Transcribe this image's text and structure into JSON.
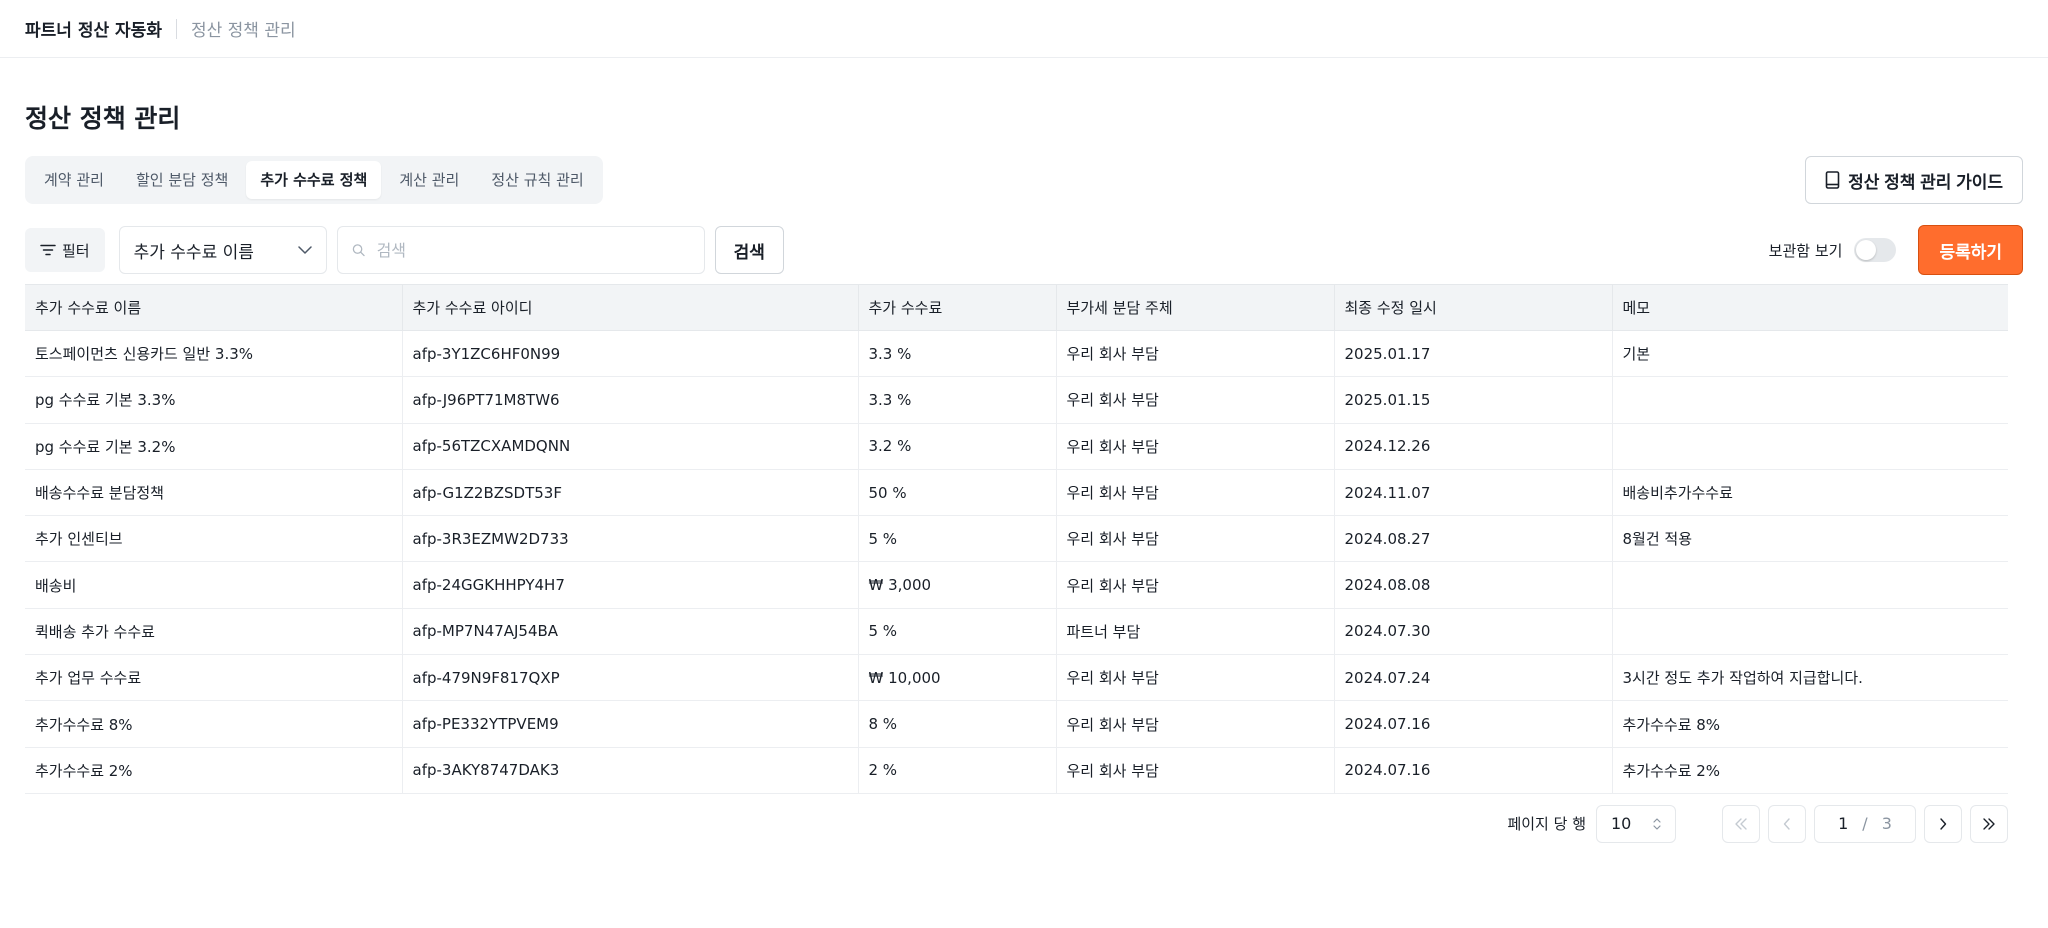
{
  "header": {
    "app_title": "파트너 정산 자동화",
    "breadcrumb": "정산 정책 관리"
  },
  "page": {
    "title": "정산 정책 관리"
  },
  "tabs": [
    {
      "label": "계약 관리",
      "active": false
    },
    {
      "label": "할인 분담 정책",
      "active": false
    },
    {
      "label": "추가 수수료 정책",
      "active": true
    },
    {
      "label": "계산 관리",
      "active": false
    },
    {
      "label": "정산 규칙 관리",
      "active": false
    }
  ],
  "guide_button": {
    "label": "정산 정책 관리 가이드",
    "icon": "book-icon"
  },
  "toolbar": {
    "filter_label": "필터",
    "select_value": "추가 수수료 이름",
    "search_placeholder": "검색",
    "search_value": "",
    "search_button": "검색",
    "archive_label": "보관함 보기",
    "archive_on": false,
    "register_button": "등록하기"
  },
  "colors": {
    "accent": "#ff6d2d",
    "header_bg": "#f2f4f6",
    "muted": "#8b95a1"
  },
  "table": {
    "columns": [
      "추가 수수료 이름",
      "추가 수수료 아이디",
      "추가 수수료",
      "부가세 분담 주체",
      "최종 수정 일시",
      "메모"
    ],
    "rows": [
      [
        "토스페이먼츠 신용카드 일반 3.3%",
        "afp-3Y1ZC6HF0N99",
        "3.3 %",
        "우리 회사 부담",
        "2025.01.17",
        "기본"
      ],
      [
        "pg 수수료 기본 3.3%",
        "afp-J96PT71M8TW6",
        "3.3 %",
        "우리 회사 부담",
        "2025.01.15",
        ""
      ],
      [
        "pg 수수료 기본 3.2%",
        "afp-56TZCXAMDQNN",
        "3.2 %",
        "우리 회사 부담",
        "2024.12.26",
        ""
      ],
      [
        "배송수수료 분담정책",
        "afp-G1Z2BZSDT53F",
        "50 %",
        "우리 회사 부담",
        "2024.11.07",
        "배송비추가수수료"
      ],
      [
        "추가 인센티브",
        "afp-3R3EZMW2D733",
        "5 %",
        "우리 회사 부담",
        "2024.08.27",
        "8월건 적용"
      ],
      [
        "배송비",
        "afp-24GGKHHPY4H7",
        "₩ 3,000",
        "우리 회사 부담",
        "2024.08.08",
        ""
      ],
      [
        "퀵배송 추가 수수료",
        "afp-MP7N47AJ54BA",
        "5 %",
        "파트너 부담",
        "2024.07.30",
        ""
      ],
      [
        "추가 업무 수수료",
        "afp-479N9F817QXP",
        "₩ 10,000",
        "우리 회사 부담",
        "2024.07.24",
        "3시간 정도 추가 작업하여 지급합니다."
      ],
      [
        "추가수수료 8%",
        "afp-PE332YTPVEM9",
        "8 %",
        "우리 회사 부담",
        "2024.07.16",
        "추가수수료 8%"
      ],
      [
        "추가수수료 2%",
        "afp-3AKY8747DAK3",
        "2 %",
        "우리 회사 부담",
        "2024.07.16",
        "추가수수료 2%"
      ]
    ]
  },
  "pagination": {
    "rows_per_page_label": "페이지 당 행",
    "rows_per_page": "10",
    "current_page": "1",
    "separator": "/",
    "total_pages": "3"
  }
}
